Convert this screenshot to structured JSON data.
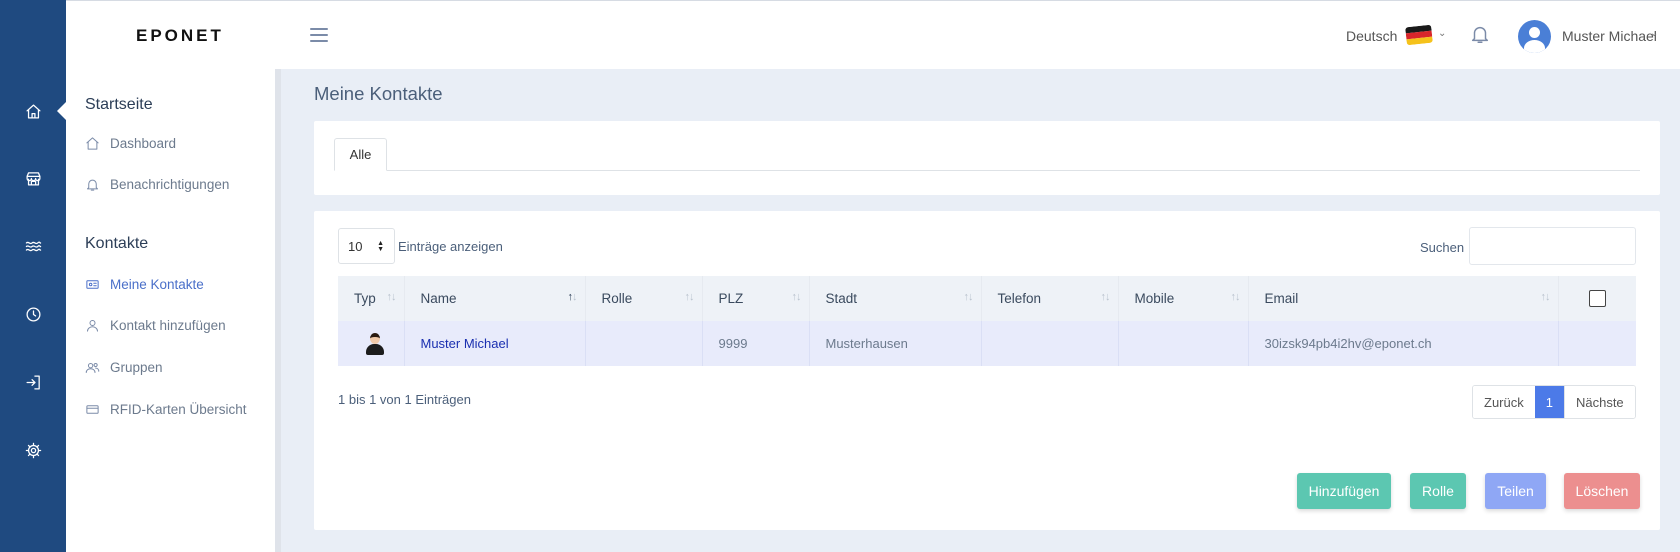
{
  "rail": {
    "icons": [
      "home-icon",
      "store-icon",
      "waves-icon",
      "clock-icon",
      "login-icon",
      "gear-icon"
    ]
  },
  "header": {
    "logo": "EPONET",
    "language": "Deutsch",
    "user_name": "Muster Michael"
  },
  "sidebar": {
    "sections": [
      {
        "title": "Startseite",
        "items": [
          {
            "label": "Dashboard",
            "icon": "home-icon"
          },
          {
            "label": "Benachrichtigungen",
            "icon": "bell-icon"
          }
        ]
      },
      {
        "title": "Kontakte",
        "items": [
          {
            "label": "Meine Kontakte",
            "icon": "contact-card-icon",
            "active": true
          },
          {
            "label": "Kontakt hinzufügen",
            "icon": "user-icon"
          },
          {
            "label": "Gruppen",
            "icon": "users-icon"
          },
          {
            "label": "RFID-Karten Übersicht",
            "icon": "credit-card-icon"
          }
        ]
      }
    ]
  },
  "main": {
    "title": "Meine Kontakte",
    "tabs": [
      {
        "label": "Alle",
        "active": true
      }
    ],
    "table": {
      "length_value": "10",
      "length_label": "Einträge anzeigen",
      "search_label": "Suchen",
      "search_value": "",
      "columns": [
        "Typ",
        "Name",
        "Rolle",
        "PLZ",
        "Stadt",
        "Telefon",
        "Mobile",
        "Email"
      ],
      "rows": [
        {
          "typ_icon": "person-avatar-icon",
          "name": "Muster Michael",
          "rolle": "",
          "plz": "9999",
          "stadt": "Musterhausen",
          "telefon": "",
          "mobile": "",
          "email": "30izsk94pb4i2hv@eponet.ch"
        }
      ],
      "info": "1 bis 1 von 1 Einträgen",
      "pagination": {
        "prev": "Zurück",
        "current": "1",
        "next": "Nächste"
      }
    },
    "actions": [
      {
        "label": "Hinzufügen",
        "color": "#5cc7b1"
      },
      {
        "label": "Rolle",
        "color": "#5cc7b1"
      },
      {
        "label": "Teilen",
        "color": "#8fa7f5"
      },
      {
        "label": "Löschen",
        "color": "#ec8f8f"
      }
    ]
  },
  "colors": {
    "rail": "#1f4a80",
    "accent": "#4c7ae8",
    "row_highlight": "#e8ebfb"
  }
}
